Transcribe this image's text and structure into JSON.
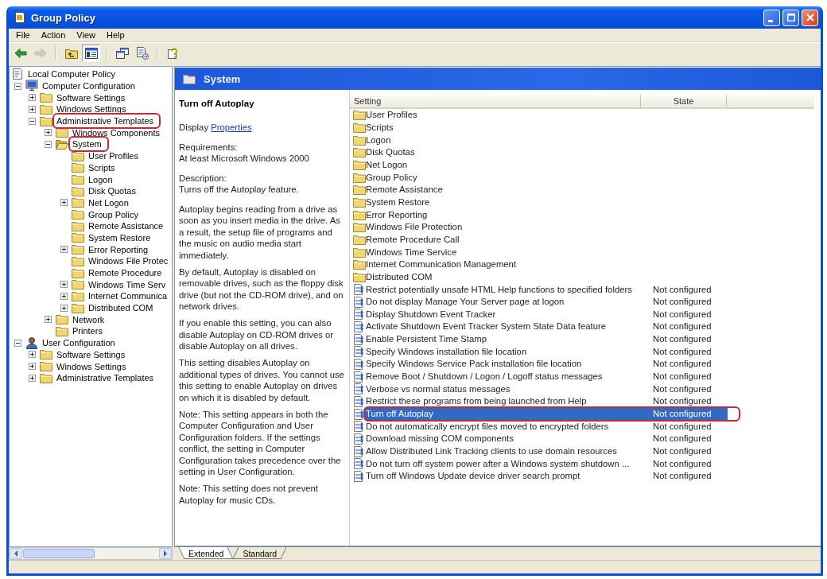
{
  "window": {
    "title": "Group Policy"
  },
  "menu": [
    "File",
    "Action",
    "View",
    "Help"
  ],
  "toolbar": [
    [
      {
        "kind": "back",
        "disabled": false,
        "pressed": false
      },
      {
        "kind": "forward",
        "disabled": true,
        "pressed": false
      }
    ],
    [
      {
        "kind": "up",
        "disabled": false,
        "pressed": false
      },
      {
        "kind": "tree",
        "disabled": false,
        "pressed": true
      }
    ],
    [
      {
        "kind": "properties",
        "disabled": false,
        "pressed": false
      },
      {
        "kind": "export",
        "disabled": false,
        "pressed": false
      }
    ],
    [
      {
        "kind": "help",
        "disabled": false,
        "pressed": false
      }
    ]
  ],
  "tree": [
    {
      "label": "Local Computer Policy",
      "kind": "policy",
      "expandable": false,
      "expanded": true,
      "selected": false,
      "circled": false,
      "children": [
        {
          "label": "Computer Configuration",
          "kind": "computer",
          "expandable": true,
          "expanded": true,
          "selected": false,
          "circled": false,
          "children": [
            {
              "label": "Software Settings",
              "kind": "folder",
              "expandable": true,
              "expanded": false,
              "selected": false,
              "circled": false
            },
            {
              "label": "Windows Settings",
              "kind": "folder",
              "expandable": true,
              "expanded": false,
              "selected": false,
              "circled": false
            },
            {
              "label": "Administrative Templates",
              "kind": "folder",
              "expandable": true,
              "expanded": true,
              "selected": false,
              "circled": true,
              "children": [
                {
                  "label": "Windows Components",
                  "kind": "folder",
                  "expandable": true,
                  "expanded": false,
                  "selected": false,
                  "circled": false
                },
                {
                  "label": "System",
                  "kind": "folder",
                  "expandable": true,
                  "expanded": true,
                  "selected": true,
                  "circled": true,
                  "children": [
                    {
                      "label": "User Profiles",
                      "kind": "folder",
                      "expandable": false,
                      "selected": false,
                      "circled": false
                    },
                    {
                      "label": "Scripts",
                      "kind": "folder",
                      "expandable": false,
                      "selected": false,
                      "circled": false
                    },
                    {
                      "label": "Logon",
                      "kind": "folder",
                      "expandable": false,
                      "selected": false,
                      "circled": false
                    },
                    {
                      "label": "Disk Quotas",
                      "kind": "folder",
                      "expandable": false,
                      "selected": false,
                      "circled": false
                    },
                    {
                      "label": "Net Logon",
                      "kind": "folder",
                      "expandable": true,
                      "expanded": false,
                      "selected": false,
                      "circled": false
                    },
                    {
                      "label": "Group Policy",
                      "kind": "folder",
                      "expandable": false,
                      "selected": false,
                      "circled": false
                    },
                    {
                      "label": "Remote Assistance",
                      "kind": "folder",
                      "expandable": false,
                      "selected": false,
                      "circled": false
                    },
                    {
                      "label": "System Restore",
                      "kind": "folder",
                      "expandable": false,
                      "selected": false,
                      "circled": false
                    },
                    {
                      "label": "Error Reporting",
                      "kind": "folder",
                      "expandable": true,
                      "expanded": false,
                      "selected": false,
                      "circled": false
                    },
                    {
                      "label": "Windows File Protec",
                      "kind": "folder",
                      "expandable": false,
                      "selected": false,
                      "circled": false
                    },
                    {
                      "label": "Remote Procedure",
                      "kind": "folder",
                      "expandable": false,
                      "selected": false,
                      "circled": false
                    },
                    {
                      "label": "Windows Time Serv",
                      "kind": "folder",
                      "expandable": true,
                      "expanded": false,
                      "selected": false,
                      "circled": false
                    },
                    {
                      "label": "Internet Communica",
                      "kind": "folder",
                      "expandable": true,
                      "expanded": false,
                      "selected": false,
                      "circled": false
                    },
                    {
                      "label": "Distributed COM",
                      "kind": "folder",
                      "expandable": true,
                      "expanded": false,
                      "selected": false,
                      "circled": false
                    }
                  ]
                },
                {
                  "label": "Network",
                  "kind": "folder",
                  "expandable": true,
                  "expanded": false,
                  "selected": false,
                  "circled": false
                },
                {
                  "label": "Printers",
                  "kind": "folder",
                  "expandable": false,
                  "selected": false,
                  "circled": false
                }
              ]
            }
          ]
        },
        {
          "label": "User Configuration",
          "kind": "user",
          "expandable": true,
          "expanded": true,
          "selected": false,
          "circled": false,
          "children": [
            {
              "label": "Software Settings",
              "kind": "folder",
              "expandable": true,
              "expanded": false,
              "selected": false,
              "circled": false
            },
            {
              "label": "Windows Settings",
              "kind": "folder",
              "expandable": true,
              "expanded": false,
              "selected": false,
              "circled": false
            },
            {
              "label": "Administrative Templates",
              "kind": "folder",
              "expandable": true,
              "expanded": false,
              "selected": false,
              "circled": false
            }
          ]
        }
      ]
    }
  ],
  "pane_header": {
    "title": "System"
  },
  "details": {
    "title": "Turn off Autoplay",
    "display_label": "Display",
    "link": "Properties",
    "requirements_label": "Requirements:",
    "requirements": "At least Microsoft Windows 2000",
    "description_label": "Description:",
    "description": "Turns off the Autoplay feature.",
    "paragraphs": [
      "Autoplay begins reading from a drive as soon as you insert media in the drive. As a result, the setup file of programs and the music on audio media start immediately.",
      "By default, Autoplay is disabled on removable drives, such as the floppy disk drive (but not the CD-ROM drive), and on network drives.",
      "If you enable this setting, you can also disable Autoplay on CD-ROM drives or disable Autoplay on all drives.",
      "This setting disables Autoplay on additional types of drives. You cannot use this setting to enable Autoplay on drives on which it is disabled by default.",
      "Note: This setting appears in both the Computer Configuration and User Configuration folders. If the settings conflict, the setting in Computer Configuration takes precedence over the setting in User Configuration.",
      "Note: This setting does not prevent Autoplay for music CDs."
    ]
  },
  "list": {
    "columns": [
      "Setting",
      "State"
    ],
    "rows": [
      {
        "kind": "folder",
        "name": "User Profiles",
        "selected": false,
        "circled": false
      },
      {
        "kind": "folder",
        "name": "Scripts",
        "selected": false,
        "circled": false
      },
      {
        "kind": "folder",
        "name": "Logon",
        "selected": false,
        "circled": false
      },
      {
        "kind": "folder",
        "name": "Disk Quotas",
        "selected": false,
        "circled": false
      },
      {
        "kind": "folder",
        "name": "Net Logon",
        "selected": false,
        "circled": false
      },
      {
        "kind": "folder",
        "name": "Group Policy",
        "selected": false,
        "circled": false
      },
      {
        "kind": "folder",
        "name": "Remote Assistance",
        "selected": false,
        "circled": false
      },
      {
        "kind": "folder",
        "name": "System Restore",
        "selected": false,
        "circled": false
      },
      {
        "kind": "folder",
        "name": "Error Reporting",
        "selected": false,
        "circled": false
      },
      {
        "kind": "folder",
        "name": "Windows File Protection",
        "selected": false,
        "circled": false
      },
      {
        "kind": "folder",
        "name": "Remote Procedure Call",
        "selected": false,
        "circled": false
      },
      {
        "kind": "folder",
        "name": "Windows Time Service",
        "selected": false,
        "circled": false
      },
      {
        "kind": "folder",
        "name": "Internet Communication Management",
        "selected": false,
        "circled": false
      },
      {
        "kind": "folder",
        "name": "Distributed COM",
        "selected": false,
        "circled": false
      },
      {
        "kind": "setting",
        "name": "Restrict potentially unsafe HTML Help functions to specified folders",
        "state": "Not configured",
        "selected": false,
        "circled": false
      },
      {
        "kind": "setting",
        "name": "Do not display Manage Your Server page at logon",
        "state": "Not configured",
        "selected": false,
        "circled": false
      },
      {
        "kind": "setting",
        "name": "Display Shutdown Event Tracker",
        "state": "Not configured",
        "selected": false,
        "circled": false
      },
      {
        "kind": "setting",
        "name": "Activate Shutdown Event Tracker System State Data feature",
        "state": "Not configured",
        "selected": false,
        "circled": false
      },
      {
        "kind": "setting",
        "name": "Enable Persistent Time Stamp",
        "state": "Not configured",
        "selected": false,
        "circled": false
      },
      {
        "kind": "setting",
        "name": "Specify Windows installation file location",
        "state": "Not configured",
        "selected": false,
        "circled": false
      },
      {
        "kind": "setting",
        "name": "Specify Windows Service Pack installation file location",
        "state": "Not configured",
        "selected": false,
        "circled": false
      },
      {
        "kind": "setting",
        "name": "Remove Boot / Shutdown / Logon / Logoff status messages",
        "state": "Not configured",
        "selected": false,
        "circled": false
      },
      {
        "kind": "setting",
        "name": "Verbose vs normal status messages",
        "state": "Not configured",
        "selected": false,
        "circled": false
      },
      {
        "kind": "setting",
        "name": "Restrict these programs from being launched from Help",
        "state": "Not configured",
        "selected": false,
        "circled": false
      },
      {
        "kind": "setting",
        "name": "Turn off Autoplay",
        "state": "Not configured",
        "selected": true,
        "circled": true
      },
      {
        "kind": "setting",
        "name": "Do not automatically encrypt files moved to encrypted folders",
        "state": "Not configured",
        "selected": false,
        "circled": false
      },
      {
        "kind": "setting",
        "name": "Download missing COM components",
        "state": "Not configured",
        "selected": false,
        "circled": false
      },
      {
        "kind": "setting",
        "name": "Allow Distributed Link Tracking clients to use domain resources",
        "state": "Not configured",
        "selected": false,
        "circled": false
      },
      {
        "kind": "setting",
        "name": "Do not turn off system power after a Windows system shutdown ...",
        "state": "Not configured",
        "selected": false,
        "circled": false
      },
      {
        "kind": "setting",
        "name": "Turn off Windows Update device driver search prompt",
        "state": "Not configured",
        "selected": false,
        "circled": false
      }
    ]
  },
  "tabs": [
    {
      "label": "Extended",
      "selected": true
    },
    {
      "label": "Standard",
      "selected": false
    }
  ]
}
